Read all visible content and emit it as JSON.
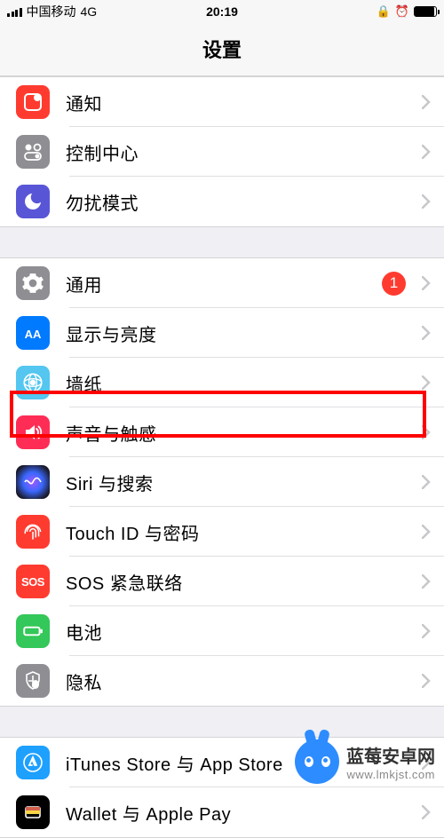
{
  "status": {
    "carrier": "中国移动",
    "network": "4G",
    "time": "20:19"
  },
  "header": {
    "title": "设置"
  },
  "rows": {
    "notifications": "通知",
    "control_center": "控制中心",
    "dnd": "勿扰模式",
    "general": "通用",
    "general_badge": "1",
    "display": "显示与亮度",
    "wallpaper": "墙纸",
    "sound": "声音与触感",
    "siri": "Siri 与搜索",
    "touchid": "Touch ID 与密码",
    "sos": "SOS 紧急联络",
    "sos_icon_text": "SOS",
    "battery": "电池",
    "privacy": "隐私",
    "itunes": "iTunes Store 与 App Store",
    "wallet": "Wallet 与 Apple Pay"
  },
  "watermark": {
    "cn": "蓝莓安卓网",
    "url": "www.lmkjst.com"
  }
}
